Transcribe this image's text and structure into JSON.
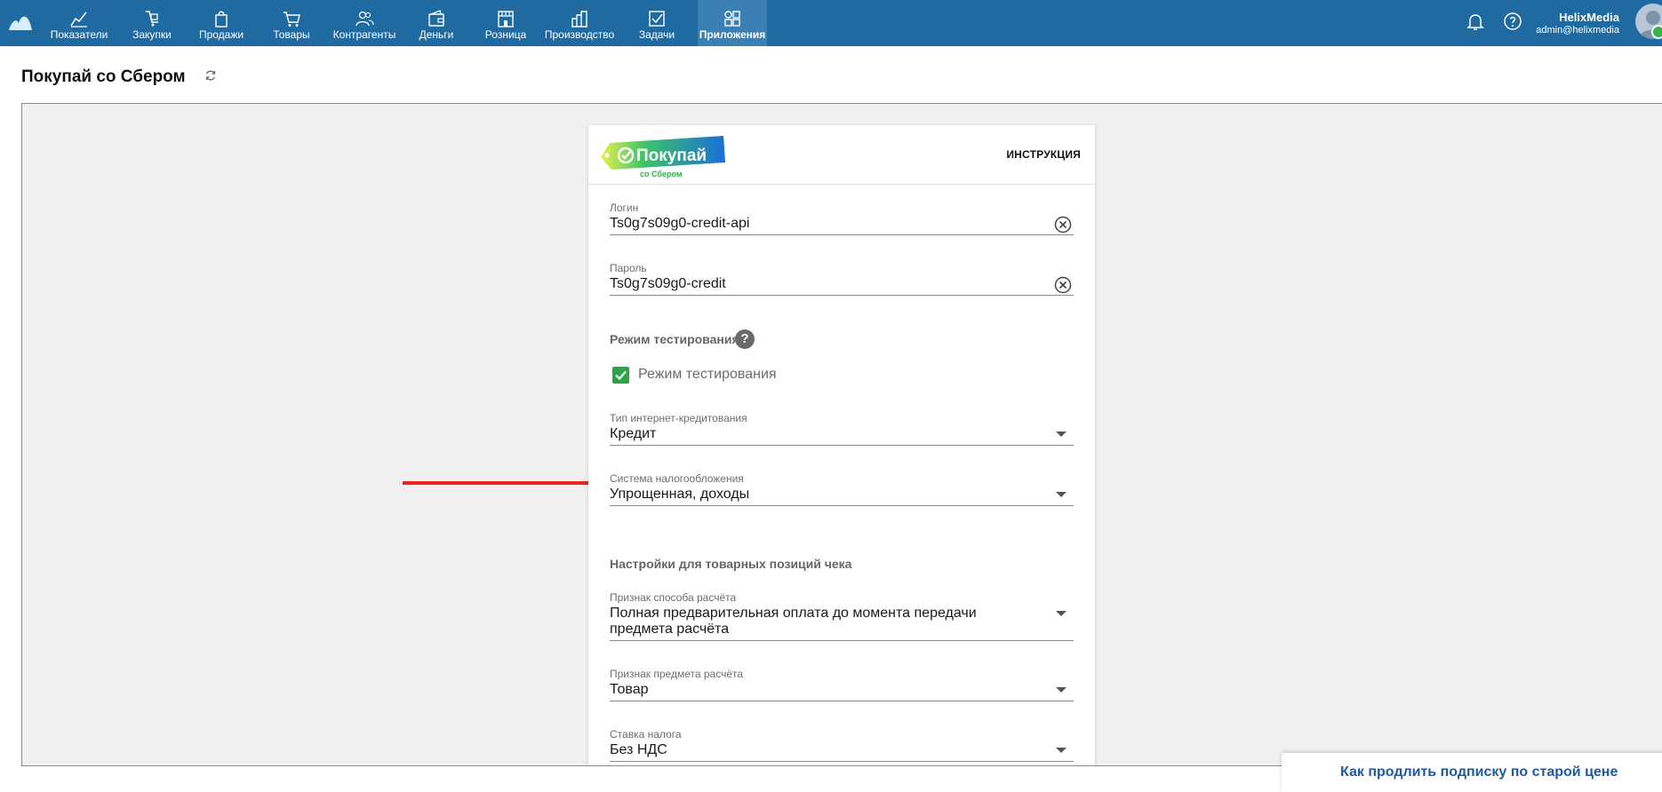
{
  "nav": {
    "items": [
      {
        "label": "Показатели",
        "icon": "chart-line-icon"
      },
      {
        "label": "Закупки",
        "icon": "hand-cart-icon"
      },
      {
        "label": "Продажи",
        "icon": "shopping-bag-icon"
      },
      {
        "label": "Товары",
        "icon": "cart-icon"
      },
      {
        "label": "Контрагенты",
        "icon": "users-icon"
      },
      {
        "label": "Деньги",
        "icon": "wallet-icon"
      },
      {
        "label": "Розница",
        "icon": "store-icon"
      },
      {
        "label": "Производство",
        "icon": "factory-icon"
      },
      {
        "label": "Задачи",
        "icon": "checkbox-icon"
      },
      {
        "label": "Приложения",
        "icon": "apps-grid-icon",
        "active": true
      }
    ],
    "user_name": "HelixMedia",
    "user_email": "admin@helixmedia"
  },
  "page": {
    "title": "Покупай со Сбером"
  },
  "card": {
    "brand": {
      "logo_text": "Покупай",
      "logo_sub": "со Сбером"
    },
    "instruction_label": "ИНСТРУКЦИЯ",
    "login": {
      "label": "Логин",
      "value": "Ts0g7s09g0-credit-api"
    },
    "password": {
      "label": "Пароль",
      "value": "Ts0g7s09g0-credit"
    },
    "test_mode": {
      "section_title": "Режим тестирования",
      "checkbox_label": "Режим тестирования",
      "checked": true
    },
    "credit_type": {
      "label": "Тип интернет-кредитования",
      "value": "Кредит"
    },
    "tax_system": {
      "label": "Система налогообложения",
      "value": "Упрощенная, доходы"
    },
    "receipt_section_title": "Настройки для товарных позиций чека",
    "payment_method": {
      "label": "Признак способа расчёта",
      "value_line1": "Полная предварительная оплата до момента передачи",
      "value_line2": "предмета расчёта"
    },
    "payment_object": {
      "label": "Признак предмета расчёта",
      "value": "Товар"
    },
    "tax_rate": {
      "label": "Ставка налога",
      "value": "Без НДС"
    }
  },
  "promo": {
    "text": "Как продлить подписку по старой цене"
  },
  "colors": {
    "topbar": "#1f6aa0",
    "active_tab": "#3a80b4",
    "checkbox": "#2ca44a",
    "arrow": "#e8231c",
    "promo_text": "#1f5aa0"
  }
}
